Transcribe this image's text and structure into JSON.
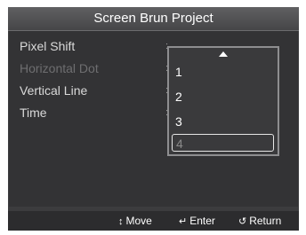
{
  "title": "Screen Brun Project",
  "menu": {
    "items": [
      {
        "label": "Pixel Shift",
        "enabled": true
      },
      {
        "label": "Horizontal Dot",
        "enabled": false
      },
      {
        "label": "Vertical Line",
        "enabled": true
      },
      {
        "label": "Time",
        "enabled": true
      }
    ],
    "separator": ":"
  },
  "dropdown": {
    "options": [
      "1",
      "2",
      "3",
      "4"
    ],
    "selected": "4"
  },
  "footer": {
    "move_icon": "updown-arrow-icon",
    "move_label": "Move",
    "enter_icon": "enter-icon",
    "enter_label": "Enter",
    "return_icon": "return-icon",
    "return_label": "Return"
  },
  "colors": {
    "background": "#3c3c3e",
    "highlight_border": "#e6e6e6",
    "text": "#ffffff"
  }
}
